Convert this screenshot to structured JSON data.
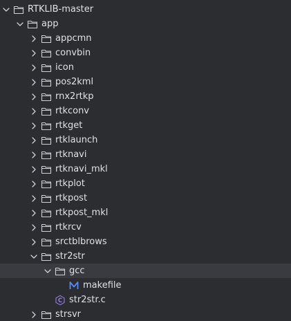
{
  "tree": [
    {
      "label": "RTKLIB-master",
      "depth": 0,
      "type": "folder",
      "expanded": true
    },
    {
      "label": "app",
      "depth": 1,
      "type": "folder",
      "expanded": true
    },
    {
      "label": "appcmn",
      "depth": 2,
      "type": "folder",
      "expanded": false
    },
    {
      "label": "convbin",
      "depth": 2,
      "type": "folder",
      "expanded": false
    },
    {
      "label": "icon",
      "depth": 2,
      "type": "folder",
      "expanded": false
    },
    {
      "label": "pos2kml",
      "depth": 2,
      "type": "folder",
      "expanded": false
    },
    {
      "label": "rnx2rtkp",
      "depth": 2,
      "type": "folder",
      "expanded": false
    },
    {
      "label": "rtkconv",
      "depth": 2,
      "type": "folder",
      "expanded": false
    },
    {
      "label": "rtkget",
      "depth": 2,
      "type": "folder",
      "expanded": false
    },
    {
      "label": "rtklaunch",
      "depth": 2,
      "type": "folder",
      "expanded": false
    },
    {
      "label": "rtknavi",
      "depth": 2,
      "type": "folder",
      "expanded": false
    },
    {
      "label": "rtknavi_mkl",
      "depth": 2,
      "type": "folder",
      "expanded": false
    },
    {
      "label": "rtkplot",
      "depth": 2,
      "type": "folder",
      "expanded": false
    },
    {
      "label": "rtkpost",
      "depth": 2,
      "type": "folder",
      "expanded": false
    },
    {
      "label": "rtkpost_mkl",
      "depth": 2,
      "type": "folder",
      "expanded": false
    },
    {
      "label": "rtkrcv",
      "depth": 2,
      "type": "folder",
      "expanded": false
    },
    {
      "label": "srctblbrows",
      "depth": 2,
      "type": "folder",
      "expanded": false
    },
    {
      "label": "str2str",
      "depth": 2,
      "type": "folder",
      "expanded": true
    },
    {
      "label": "gcc",
      "depth": 3,
      "type": "folder",
      "expanded": true,
      "selected": true
    },
    {
      "label": "makefile",
      "depth": 4,
      "type": "makefile"
    },
    {
      "label": "str2str.c",
      "depth": 3,
      "type": "c-file"
    },
    {
      "label": "strsvr",
      "depth": 2,
      "type": "folder",
      "expanded": false
    }
  ],
  "colors": {
    "background": "#2b2d30",
    "selected_row": "#393b40",
    "text": "#dfe1e5",
    "icon_stroke": "#ced0d6",
    "makefile_icon": "#548af7",
    "c_file_icon": "#9a7ce8"
  }
}
